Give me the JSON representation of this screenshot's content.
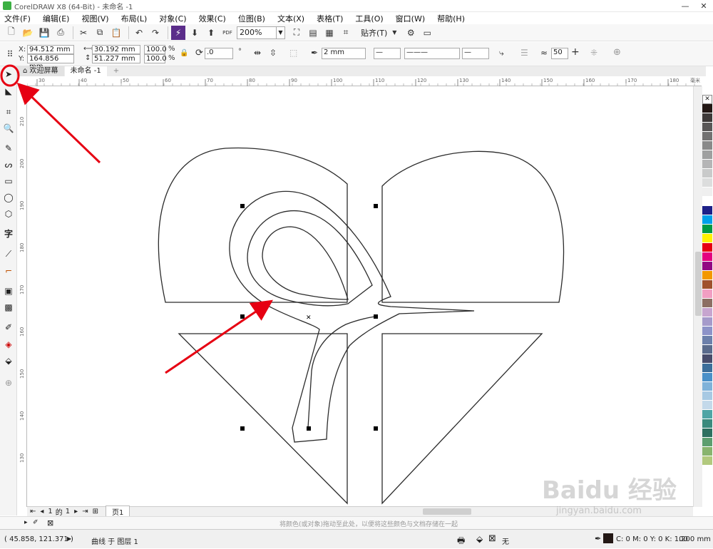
{
  "window": {
    "title": "CorelDRAW X8 (64-Bit) - 未命名 -1",
    "min": "—",
    "close": "✕"
  },
  "menu": [
    "文件(F)",
    "编辑(E)",
    "视图(V)",
    "布局(L)",
    "对象(C)",
    "效果(C)",
    "位图(B)",
    "文本(X)",
    "表格(T)",
    "工具(O)",
    "窗口(W)",
    "帮助(H)"
  ],
  "toolbar": {
    "zoom": "200%",
    "snap": "贴齐(T)",
    "pdf": "PDF"
  },
  "property_bar": {
    "x_label": "X:",
    "x": "94.512 mm",
    "y_label": "Y:",
    "y": "164.856 mm",
    "w": "30.192 mm",
    "h": "51.227 mm",
    "sx": "100.0",
    "sy": "100.0",
    "pct": "%",
    "rotation": ".0",
    "degree": "°",
    "outline_width": "2 mm",
    "smoothing": "50"
  },
  "doc_tabs": [
    "欢迎屏幕",
    "未命名 -1",
    "+"
  ],
  "ruler_h": [
    "30",
    "40",
    "50",
    "60",
    "70",
    "80",
    "90",
    "100",
    "110",
    "120",
    "130",
    "140",
    "150",
    "160",
    "170",
    "180",
    "毫米"
  ],
  "ruler_v": [
    "210",
    "200",
    "190",
    "180",
    "170",
    "160",
    "150",
    "140",
    "130"
  ],
  "page_nav": {
    "current": "1",
    "of": "的",
    "total": "1",
    "page_tab": "页1"
  },
  "hint": "将颜色(或对象)拖动至此处，以便将这些颜色与文档存储在一起",
  "status": {
    "coords": "( 45.858, 121.371 )",
    "object_info": "曲线 于 图层 1",
    "fill_none": "无",
    "color_info": "C: 0 M: 0 Y: 0 K: 100",
    "outline": ".200 mm"
  },
  "watermark": {
    "brand": "Baidu 经验",
    "url": "jingyan.baidu.com"
  },
  "palette_colors": [
    "#231815",
    "#3e3a39",
    "#595757",
    "#727171",
    "#898989",
    "#9fa0a0",
    "#b5b5b6",
    "#c9caca",
    "#dcdddd",
    "#efefef",
    "#ffffff",
    "#1d2088",
    "#00a0e9",
    "#009944",
    "#fff100",
    "#e60012",
    "#e4007f",
    "#920783",
    "#f39800",
    "#a0522d",
    "#f19ec2",
    "#8c6e63",
    "#c7a5cf",
    "#a59aca",
    "#8d93c8",
    "#6c80ab",
    "#5a6b8c",
    "#484c6b",
    "#3c6e9a",
    "#4a90c8",
    "#7fb2d9",
    "#a7c9e3",
    "#c3d9ea",
    "#4fa5a5",
    "#3a8a7d",
    "#2d7060",
    "#5c9e6f",
    "#88b46e",
    "#b2c97e"
  ],
  "accent": "#e60012"
}
